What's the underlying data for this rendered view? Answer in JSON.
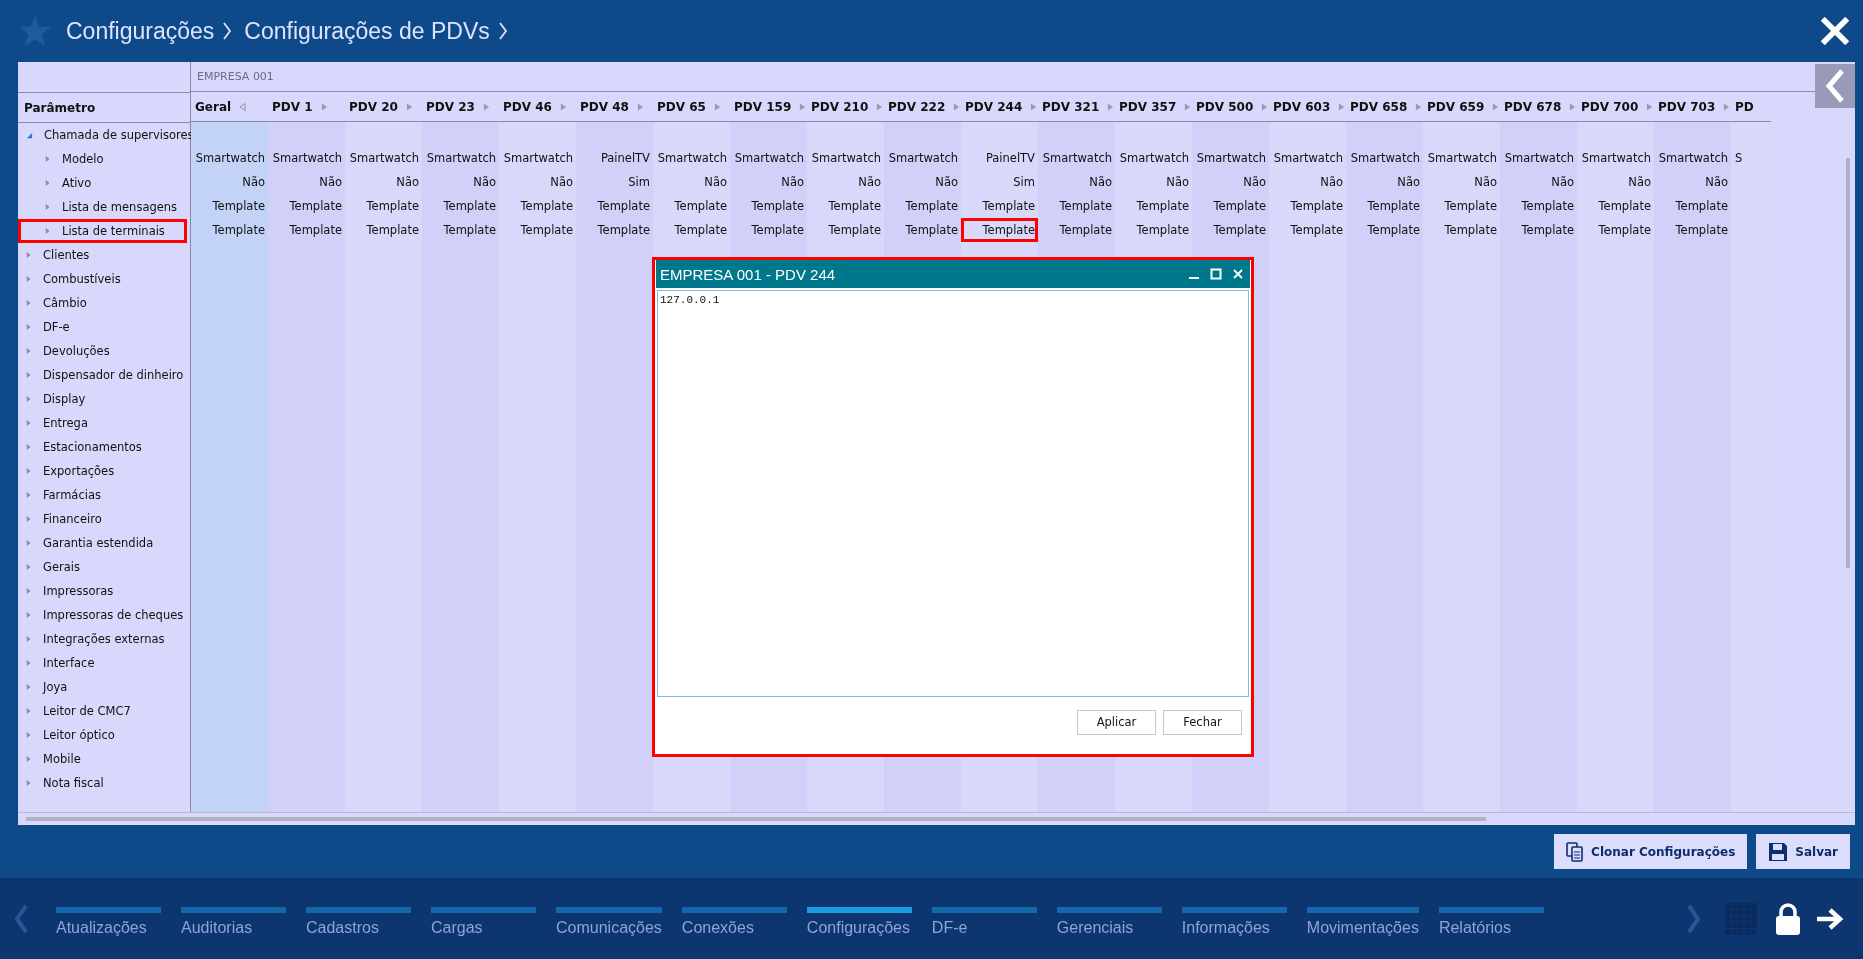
{
  "header": {
    "breadcrumb": [
      "Configurações",
      "Configurações de PDVs"
    ]
  },
  "grid": {
    "company": "EMPRESA 001",
    "parameter_heading": "Parâmetro",
    "tree": [
      {
        "label": "Chamada de supervisores",
        "expanded": true,
        "highlighted": false,
        "children": [
          {
            "label": "Modelo",
            "expanded": false,
            "highlighted": false
          },
          {
            "label": "Ativo",
            "expanded": false,
            "highlighted": false
          },
          {
            "label": "Lista de mensagens",
            "expanded": false,
            "highlighted": false
          },
          {
            "label": "Lista de terminais",
            "expanded": false,
            "highlighted": true
          }
        ]
      },
      {
        "label": "Clientes",
        "expanded": false,
        "highlighted": false
      },
      {
        "label": "Combustíveis",
        "expanded": false,
        "highlighted": false
      },
      {
        "label": "Câmbio",
        "expanded": false,
        "highlighted": false
      },
      {
        "label": "DF-e",
        "expanded": false,
        "highlighted": false
      },
      {
        "label": "Devoluções",
        "expanded": false,
        "highlighted": false
      },
      {
        "label": "Dispensador de dinheiro",
        "expanded": false,
        "highlighted": false
      },
      {
        "label": "Display",
        "expanded": false,
        "highlighted": false
      },
      {
        "label": "Entrega",
        "expanded": false,
        "highlighted": false
      },
      {
        "label": "Estacionamentos",
        "expanded": false,
        "highlighted": false
      },
      {
        "label": "Exportações",
        "expanded": false,
        "highlighted": false
      },
      {
        "label": "Farmácias",
        "expanded": false,
        "highlighted": false
      },
      {
        "label": "Financeiro",
        "expanded": false,
        "highlighted": false
      },
      {
        "label": "Garantia estendida",
        "expanded": false,
        "highlighted": false
      },
      {
        "label": "Gerais",
        "expanded": false,
        "highlighted": false
      },
      {
        "label": "Impressoras",
        "expanded": false,
        "highlighted": false
      },
      {
        "label": "Impressoras de cheques",
        "expanded": false,
        "highlighted": false
      },
      {
        "label": "Integrações externas",
        "expanded": false,
        "highlighted": false
      },
      {
        "label": "Interface",
        "expanded": false,
        "highlighted": false
      },
      {
        "label": "Joya",
        "expanded": false,
        "highlighted": false
      },
      {
        "label": "Leitor de CMC7",
        "expanded": false,
        "highlighted": false
      },
      {
        "label": "Leitor óptico",
        "expanded": false,
        "highlighted": false
      },
      {
        "label": "Mobile",
        "expanded": false,
        "highlighted": false
      },
      {
        "label": "Nota fiscal",
        "expanded": false,
        "highlighted": false
      }
    ],
    "columns": [
      {
        "label": "Geral",
        "selected": true,
        "expanded": true,
        "cells": [
          {
            "text": "Smartwatch",
            "highlighted": false
          },
          {
            "text": "Não",
            "highlighted": false
          },
          {
            "text": "Template",
            "highlighted": false
          },
          {
            "text": "Template",
            "highlighted": false
          }
        ]
      },
      {
        "label": "PDV 1",
        "selected": false,
        "expanded": false,
        "cells": [
          {
            "text": "Smartwatch",
            "highlighted": false
          },
          {
            "text": "Não",
            "highlighted": false
          },
          {
            "text": "Template",
            "highlighted": false
          },
          {
            "text": "Template",
            "highlighted": false
          }
        ]
      },
      {
        "label": "PDV 20",
        "selected": false,
        "expanded": false,
        "cells": [
          {
            "text": "Smartwatch",
            "highlighted": false
          },
          {
            "text": "Não",
            "highlighted": false
          },
          {
            "text": "Template",
            "highlighted": false
          },
          {
            "text": "Template",
            "highlighted": false
          }
        ]
      },
      {
        "label": "PDV 23",
        "selected": false,
        "expanded": false,
        "cells": [
          {
            "text": "Smartwatch",
            "highlighted": false
          },
          {
            "text": "Não",
            "highlighted": false
          },
          {
            "text": "Template",
            "highlighted": false
          },
          {
            "text": "Template",
            "highlighted": false
          }
        ]
      },
      {
        "label": "PDV 46",
        "selected": false,
        "expanded": false,
        "cells": [
          {
            "text": "Smartwatch",
            "highlighted": false
          },
          {
            "text": "Não",
            "highlighted": false
          },
          {
            "text": "Template",
            "highlighted": false
          },
          {
            "text": "Template",
            "highlighted": false
          }
        ]
      },
      {
        "label": "PDV 48",
        "selected": false,
        "expanded": false,
        "cells": [
          {
            "text": "PainelTV",
            "highlighted": false
          },
          {
            "text": "Sim",
            "highlighted": false
          },
          {
            "text": "Template",
            "highlighted": false
          },
          {
            "text": "Template",
            "highlighted": false
          }
        ]
      },
      {
        "label": "PDV 65",
        "selected": false,
        "expanded": false,
        "cells": [
          {
            "text": "Smartwatch",
            "highlighted": false
          },
          {
            "text": "Não",
            "highlighted": false
          },
          {
            "text": "Template",
            "highlighted": false
          },
          {
            "text": "Template",
            "highlighted": false
          }
        ]
      },
      {
        "label": "PDV 159",
        "selected": false,
        "expanded": false,
        "cells": [
          {
            "text": "Smartwatch",
            "highlighted": false
          },
          {
            "text": "Não",
            "highlighted": false
          },
          {
            "text": "Template",
            "highlighted": false
          },
          {
            "text": "Template",
            "highlighted": false
          }
        ]
      },
      {
        "label": "PDV 210",
        "selected": false,
        "expanded": false,
        "cells": [
          {
            "text": "Smartwatch",
            "highlighted": false
          },
          {
            "text": "Não",
            "highlighted": false
          },
          {
            "text": "Template",
            "highlighted": false
          },
          {
            "text": "Template",
            "highlighted": false
          }
        ]
      },
      {
        "label": "PDV 222",
        "selected": false,
        "expanded": false,
        "cells": [
          {
            "text": "Smartwatch",
            "highlighted": false
          },
          {
            "text": "Não",
            "highlighted": false
          },
          {
            "text": "Template",
            "highlighted": false
          },
          {
            "text": "Template",
            "highlighted": false
          }
        ]
      },
      {
        "label": "PDV 244",
        "selected": false,
        "expanded": false,
        "cells": [
          {
            "text": "PainelTV",
            "highlighted": false
          },
          {
            "text": "Sim",
            "highlighted": false
          },
          {
            "text": "Template",
            "highlighted": false
          },
          {
            "text": "Template",
            "highlighted": true
          }
        ]
      },
      {
        "label": "PDV 321",
        "selected": false,
        "expanded": false,
        "cells": [
          {
            "text": "Smartwatch",
            "highlighted": false
          },
          {
            "text": "Não",
            "highlighted": false
          },
          {
            "text": "Template",
            "highlighted": false
          },
          {
            "text": "Template",
            "highlighted": false
          }
        ]
      },
      {
        "label": "PDV 357",
        "selected": false,
        "expanded": false,
        "cells": [
          {
            "text": "Smartwatch",
            "highlighted": false
          },
          {
            "text": "Não",
            "highlighted": false
          },
          {
            "text": "Template",
            "highlighted": false
          },
          {
            "text": "Template",
            "highlighted": false
          }
        ]
      },
      {
        "label": "PDV 500",
        "selected": false,
        "expanded": false,
        "cells": [
          {
            "text": "Smartwatch",
            "highlighted": false
          },
          {
            "text": "Não",
            "highlighted": false
          },
          {
            "text": "Template",
            "highlighted": false
          },
          {
            "text": "Template",
            "highlighted": false
          }
        ]
      },
      {
        "label": "PDV 603",
        "selected": false,
        "expanded": false,
        "cells": [
          {
            "text": "Smartwatch",
            "highlighted": false
          },
          {
            "text": "Não",
            "highlighted": false
          },
          {
            "text": "Template",
            "highlighted": false
          },
          {
            "text": "Template",
            "highlighted": false
          }
        ]
      },
      {
        "label": "PDV 658",
        "selected": false,
        "expanded": false,
        "cells": [
          {
            "text": "Smartwatch",
            "highlighted": false
          },
          {
            "text": "Não",
            "highlighted": false
          },
          {
            "text": "Template",
            "highlighted": false
          },
          {
            "text": "Template",
            "highlighted": false
          }
        ]
      },
      {
        "label": "PDV 659",
        "selected": false,
        "expanded": false,
        "cells": [
          {
            "text": "Smartwatch",
            "highlighted": false
          },
          {
            "text": "Não",
            "highlighted": false
          },
          {
            "text": "Template",
            "highlighted": false
          },
          {
            "text": "Template",
            "highlighted": false
          }
        ]
      },
      {
        "label": "PDV 678",
        "selected": false,
        "expanded": false,
        "cells": [
          {
            "text": "Smartwatch",
            "highlighted": false
          },
          {
            "text": "Não",
            "highlighted": false
          },
          {
            "text": "Template",
            "highlighted": false
          },
          {
            "text": "Template",
            "highlighted": false
          }
        ]
      },
      {
        "label": "PDV 700",
        "selected": false,
        "expanded": false,
        "cells": [
          {
            "text": "Smartwatch",
            "highlighted": false
          },
          {
            "text": "Não",
            "highlighted": false
          },
          {
            "text": "Template",
            "highlighted": false
          },
          {
            "text": "Template",
            "highlighted": false
          }
        ]
      },
      {
        "label": "PDV 703",
        "selected": false,
        "expanded": false,
        "cells": [
          {
            "text": "Smartwatch",
            "highlighted": false
          },
          {
            "text": "Não",
            "highlighted": false
          },
          {
            "text": "Template",
            "highlighted": false
          },
          {
            "text": "Template",
            "highlighted": false
          }
        ]
      },
      {
        "label": "PD",
        "selected": false,
        "cells": [
          {
            "text": "S",
            "highlighted": false
          }
        ]
      }
    ]
  },
  "dialog": {
    "title": "EMPRESA 001 - PDV 244",
    "value": "127.0.0.1",
    "highlighted": true,
    "buttons": [
      "Aplicar",
      "Fechar"
    ]
  },
  "actions": [
    {
      "label": "Clonar Configurações",
      "kind": "clone"
    },
    {
      "label": "Salvar",
      "kind": "save"
    }
  ],
  "nav": [
    {
      "label": "Atualizações",
      "selected": false
    },
    {
      "label": "Auditorias",
      "selected": false
    },
    {
      "label": "Cadastros",
      "selected": false
    },
    {
      "label": "Cargas",
      "selected": false
    },
    {
      "label": "Comunicações",
      "selected": false
    },
    {
      "label": "Conexões",
      "selected": false
    },
    {
      "label": "Configurações",
      "selected": true
    },
    {
      "label": "DF-e",
      "selected": false
    },
    {
      "label": "Gerenciais",
      "selected": false
    },
    {
      "label": "Informações",
      "selected": false
    },
    {
      "label": "Movimentações",
      "selected": false
    },
    {
      "label": "Relatórios",
      "selected": false
    }
  ]
}
